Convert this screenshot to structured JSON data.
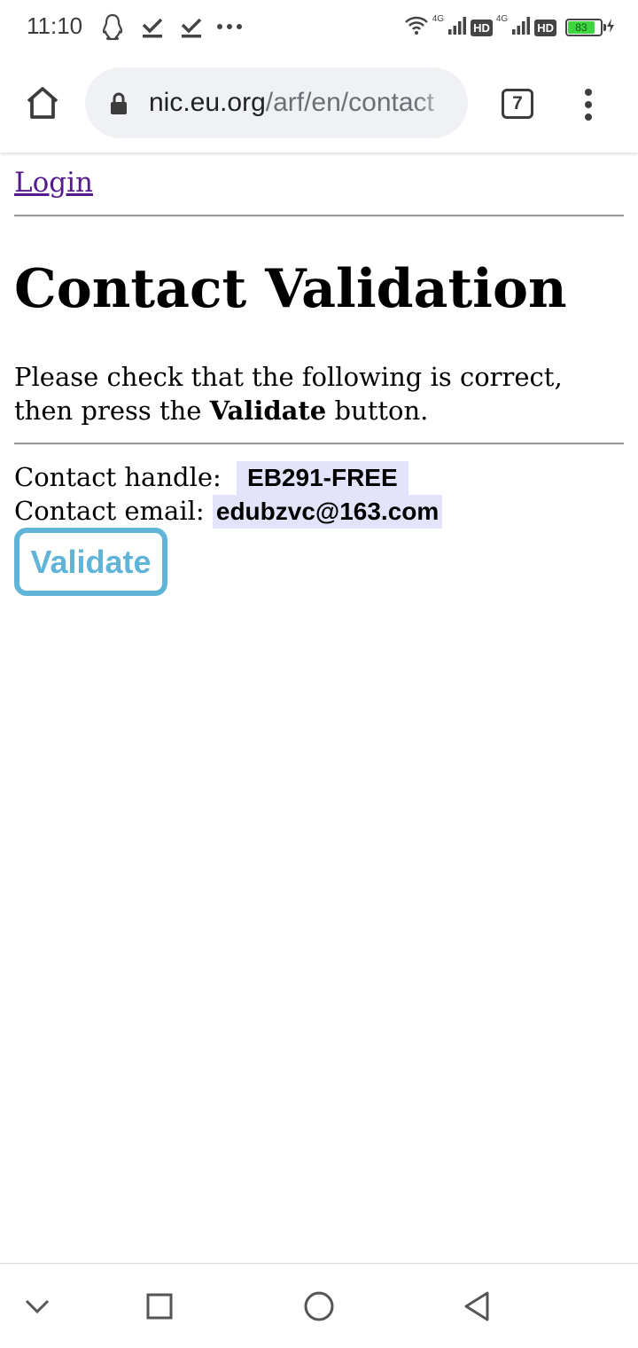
{
  "status_bar": {
    "time": "11:10",
    "network_1": "4G",
    "network_2": "4G",
    "hd_1": "HD",
    "hd_2": "HD",
    "battery": "83",
    "battery_level": 0.83
  },
  "browser": {
    "url_domain": "nic.eu.org",
    "url_path": "/arf/en/contact",
    "tab_count": "7"
  },
  "page": {
    "login_link": "Login",
    "title": "Contact Validation",
    "intro_before": "Please check that the following is correct, then press the ",
    "intro_bold": "Validate",
    "intro_after": " button.",
    "handle_label": "Contact handle: ",
    "handle_value": "EB291-FREE",
    "email_label": "Contact email: ",
    "email_value": "edubzvc@163.com",
    "validate_button": "Validate"
  },
  "colors": {
    "link": "#551a8b",
    "button_accent": "#5fb4d8",
    "value_highlight": "#e3e3fb",
    "battery": "#3ed63e"
  }
}
